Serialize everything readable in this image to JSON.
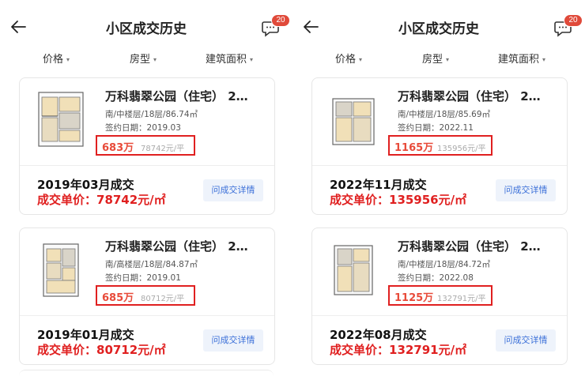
{
  "panels": [
    {
      "header": {
        "title": "小区成交历史",
        "badge": "20"
      },
      "filters": [
        "价格",
        "房型",
        "建筑面积"
      ],
      "cards": [
        {
          "title": "万科翡翠公园（住宅）  2…",
          "info": "南/中楼层/18层/86.74㎡",
          "date": "签约日期：2019.03",
          "price": "683万",
          "unit_price": "78742元/平",
          "deal_date": "2019年03月成交",
          "deal_unit_price": "成交单价：78742元/㎡",
          "button": "问成交详情"
        },
        {
          "title": "万科翡翠公园（住宅）  2…",
          "info": "南/高楼层/18层/84.87㎡",
          "date": "签约日期：2019.01",
          "price": "685万",
          "unit_price": "80712元/平",
          "deal_date": "2019年01月成交",
          "deal_unit_price": "成交单价：80712元/㎡",
          "button": "问成交详情"
        }
      ]
    },
    {
      "header": {
        "title": "小区成交历史",
        "badge": "20"
      },
      "filters": [
        "价格",
        "房型",
        "建筑面积"
      ],
      "cards": [
        {
          "title": "万科翡翠公园（住宅）  2…",
          "info": "南/中楼层/18层/85.69㎡",
          "date": "签约日期：2022.11",
          "price": "1165万",
          "unit_price": "135956元/平",
          "deal_date": "2022年11月成交",
          "deal_unit_price": "成交单价：135956元/㎡",
          "button": "问成交详情"
        },
        {
          "title": "万科翡翠公园（住宅）  2…",
          "info": "南/中楼层/18层/84.72㎡",
          "date": "签约日期：2022.08",
          "price": "1125万",
          "unit_price": "132791元/平",
          "deal_date": "2022年08月成交",
          "deal_unit_price": "成交单价：132791元/㎡",
          "button": "问成交详情"
        }
      ]
    }
  ],
  "colors": {
    "accent_red": "#e02020",
    "price_red": "#e84b3a",
    "link_blue": "#3a6fd8",
    "badge_red": "#e04a3a"
  },
  "icons": {
    "back": "arrow-left-icon",
    "messages": "chat-bubble-icon",
    "filter_caret": "caret-down-icon",
    "thumbnail": "floor-plan-icon"
  }
}
